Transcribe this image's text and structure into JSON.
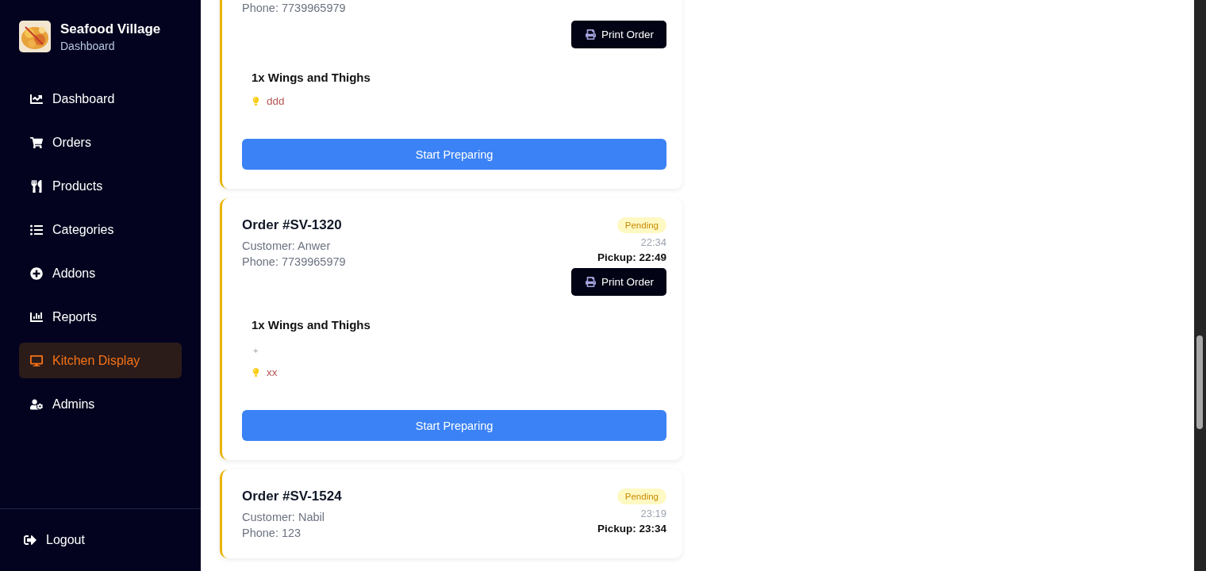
{
  "brand": {
    "title": "Seafood Village",
    "subtitle": "Dashboard"
  },
  "nav": [
    {
      "label": "Dashboard",
      "selected": false
    },
    {
      "label": "Orders",
      "selected": false
    },
    {
      "label": "Products",
      "selected": false
    },
    {
      "label": "Categories",
      "selected": false
    },
    {
      "label": "Addons",
      "selected": false
    },
    {
      "label": "Reports",
      "selected": false
    },
    {
      "label": "Kitchen Display",
      "selected": true
    },
    {
      "label": "Admins",
      "selected": false
    }
  ],
  "logout": {
    "label": "Logout"
  },
  "orders": [
    {
      "phone": "Phone: 7739965979",
      "print_label": "Print Order",
      "items": [
        {
          "name": "1x Wings and Thighs",
          "note": "ddd"
        }
      ],
      "action": "Start Preparing"
    },
    {
      "title": "Order #SV-1320",
      "customer": "Customer: Anwer",
      "phone": "Phone: 7739965979",
      "status": "Pending",
      "time": "22:34",
      "pickup": "Pickup: 22:49",
      "print_label": "Print Order",
      "items": [
        {
          "name": "1x Wings and Thighs",
          "addons": [
            "+"
          ],
          "note": "xx"
        }
      ],
      "action": "Start Preparing"
    },
    {
      "title": "Order #SV-1524",
      "customer": "Customer: Nabil",
      "phone": "Phone: 123",
      "status": "Pending",
      "time": "23:19",
      "pickup": "Pickup: 23:34"
    }
  ]
}
